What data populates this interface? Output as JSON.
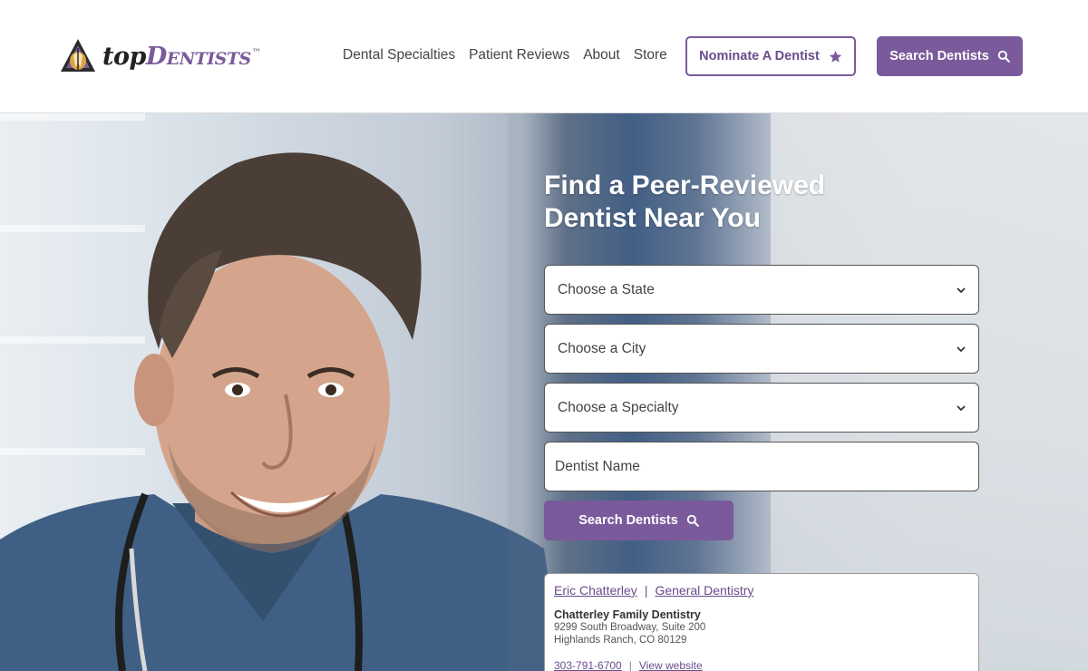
{
  "header": {
    "logo": {
      "prefix": "top",
      "brand": "Dentists",
      "tm": "™"
    },
    "nav": [
      "Dental Specialties",
      "Patient Reviews",
      "About",
      "Store"
    ],
    "nominate_label": "Nominate A Dentist",
    "search_label": "Search Dentists"
  },
  "hero": {
    "title_line1": "Find a Peer-Reviewed",
    "title_line2": "Dentist Near You",
    "state_select": "Choose a State",
    "city_select": "Choose a City",
    "specialty_select": "Choose a Specialty",
    "name_placeholder": "Dentist Name",
    "search_label": "Search Dentists"
  },
  "result_card": {
    "dentist_name": "Eric Chatterley",
    "separator": "|",
    "specialty": "General Dentistry",
    "practice": "Chatterley Family Dentistry",
    "address_line1": "9299 South Broadway, Suite 200",
    "address_line2": "Highlands Ranch, CO 80129",
    "phone": "303-791-6700",
    "website_label": "View website"
  },
  "colors": {
    "brand_purple": "#7a5a9b",
    "text_dark": "#444444"
  },
  "icons": [
    "logo-emblem-icon",
    "star-icon",
    "search-icon",
    "chevron-down-icon"
  ]
}
